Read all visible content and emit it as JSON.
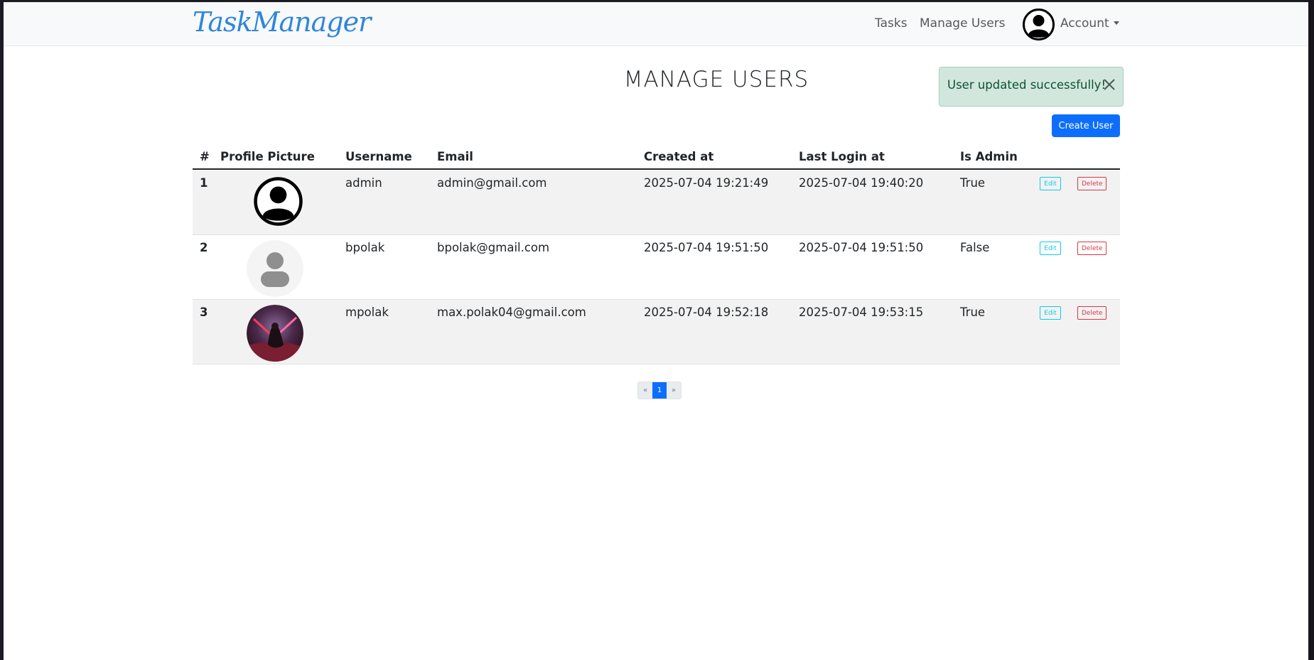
{
  "navbar": {
    "brand": "TaskManager",
    "links": [
      "Tasks",
      "Manage Users"
    ],
    "account_label": "Account"
  },
  "page": {
    "title": "MANAGE USERS"
  },
  "alert": {
    "message": "User updated successfully!"
  },
  "actions": {
    "create_user": "Create User"
  },
  "table": {
    "headers": [
      "#",
      "Profile Picture",
      "Username",
      "Email",
      "Created at",
      "Last Login at",
      "Is Admin"
    ],
    "rows": [
      {
        "id": "1",
        "picture": "default-silhouette",
        "username": "admin",
        "email": "admin@gmail.com",
        "created_at": "2025-07-04 19:21:49",
        "last_login": "2025-07-04 19:40:20",
        "is_admin": "True",
        "edit": "Edit",
        "delete": "Delete"
      },
      {
        "id": "2",
        "picture": "grey-placeholder",
        "username": "bpolak",
        "email": "bpolak@gmail.com",
        "created_at": "2025-07-04 19:51:50",
        "last_login": "2025-07-04 19:51:50",
        "is_admin": "False",
        "edit": "Edit",
        "delete": "Delete"
      },
      {
        "id": "3",
        "picture": "sith-artwork",
        "username": "mpolak",
        "email": "max.polak04@gmail.com",
        "created_at": "2025-07-04 19:52:18",
        "last_login": "2025-07-04 19:53:15",
        "is_admin": "True",
        "edit": "Edit",
        "delete": "Delete"
      }
    ]
  },
  "pagination": {
    "prev": "«",
    "current": "1",
    "next": "»"
  },
  "colors": {
    "brand": "#2f86d8",
    "primary": "#0d6efd",
    "alert_bg": "#d1e7dd",
    "edit": "#0dcaf0",
    "delete": "#dc3545"
  }
}
